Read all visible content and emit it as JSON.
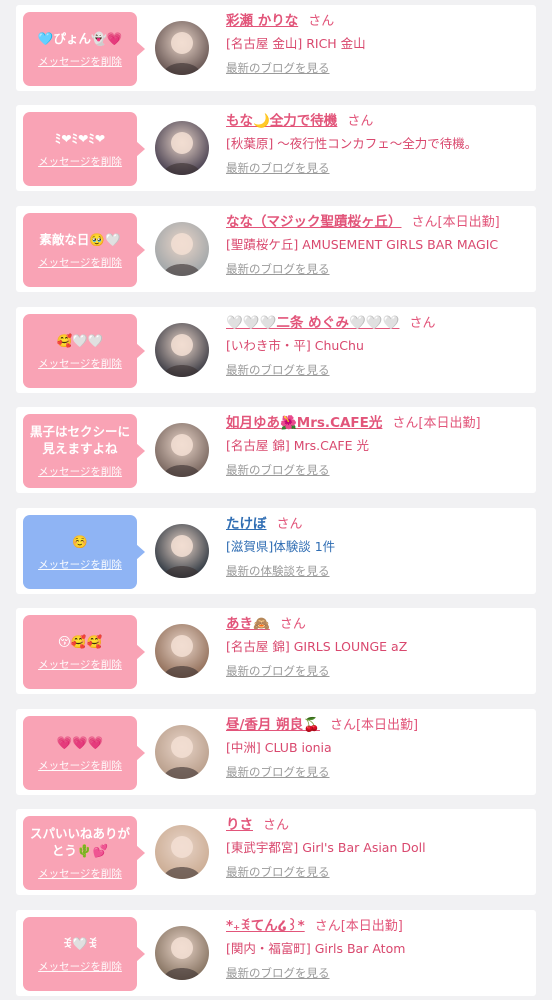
{
  "delete_label": "メッセージを削除",
  "san_label": "さん",
  "blog_link": "最新のブログを見る",
  "review_link": "最新の体験談を見る",
  "items": [
    {
      "msg": "🩵ぴょん👻💗",
      "name": "彩瀬 かりな",
      "suffix": "",
      "shop": "[名古屋 金山] RICH 金山",
      "more": "最新のブログを見る",
      "color": "pink",
      "avatar": "#5b4a48"
    },
    {
      "msg": "ﾐ❤ﾐ❤ﾐ❤",
      "name": "もな🌙全力で待機",
      "suffix": "",
      "shop": "[秋葉原] 〜夜行性コンカフェ〜全力で待機。",
      "more": "最新のブログを見る",
      "color": "pink",
      "avatar": "#3b3447"
    },
    {
      "msg": "素敵な日🥹🤍",
      "name": "なな（マジック聖蹟桜ヶ丘）",
      "suffix": "[本日出勤]",
      "shop": "[聖蹟桜ケ丘] AMUSEMENT GIRLS BAR MAGIC",
      "more": "最新のブログを見る",
      "color": "pink",
      "avatar": "#9aa2a6"
    },
    {
      "msg": "🥰🤍🤍",
      "name": "🤍🤍🤍二条 めぐみ🤍🤍🤍",
      "suffix": "",
      "shop": "[いわき市・平] ChuChu",
      "more": "最新のブログを見る",
      "color": "pink",
      "avatar": "#2d2f3a"
    },
    {
      "msg": "黒子はセクシーに\n見えますよね",
      "name": "如月ゆあ🌺Mrs.CAFE光",
      "suffix": "[本日出勤]",
      "shop": "[名古屋 錦] Mrs.CAFE 光",
      "more": "最新のブログを見る",
      "color": "pink",
      "avatar": "#6e5c55"
    },
    {
      "msg": "☺️",
      "name": "たけぼ",
      "suffix": "",
      "shop": "[滋賀県]体験談 1件",
      "more": "最新の体験談を見る",
      "color": "blue",
      "avatar": "#1f2a36"
    },
    {
      "msg": "😚🥰🥰",
      "name": "あき🙈",
      "suffix": "",
      "shop": "[名古屋 錦] GIRLS LOUNGE aZ",
      "more": "最新のブログを見る",
      "color": "pink",
      "avatar": "#8a6650"
    },
    {
      "msg": "💗💗💗",
      "name": "昼/香月 朔良🍒",
      "suffix": "[本日出勤]",
      "shop": "[中洲] CLUB ionia",
      "more": "最新のブログを見る",
      "color": "pink",
      "avatar": "#b59a86"
    },
    {
      "msg": "スパいいねありが\nとう🌵💕",
      "name": "りさ",
      "suffix": "",
      "shop": "[東武宇都宮] Girl's Bar Asian Doll",
      "more": "最新のブログを見る",
      "color": "pink",
      "avatar": "#c9a98f"
    },
    {
      "msg": "ꉂ🤍ꉂ",
      "name": "*₊ꉂてん໒꒱*",
      "suffix": "[本日出勤]",
      "shop": "[関内・福富町] Girls Bar Atom",
      "more": "最新のブログを見る",
      "color": "pink",
      "avatar": "#7d6a58"
    }
  ]
}
